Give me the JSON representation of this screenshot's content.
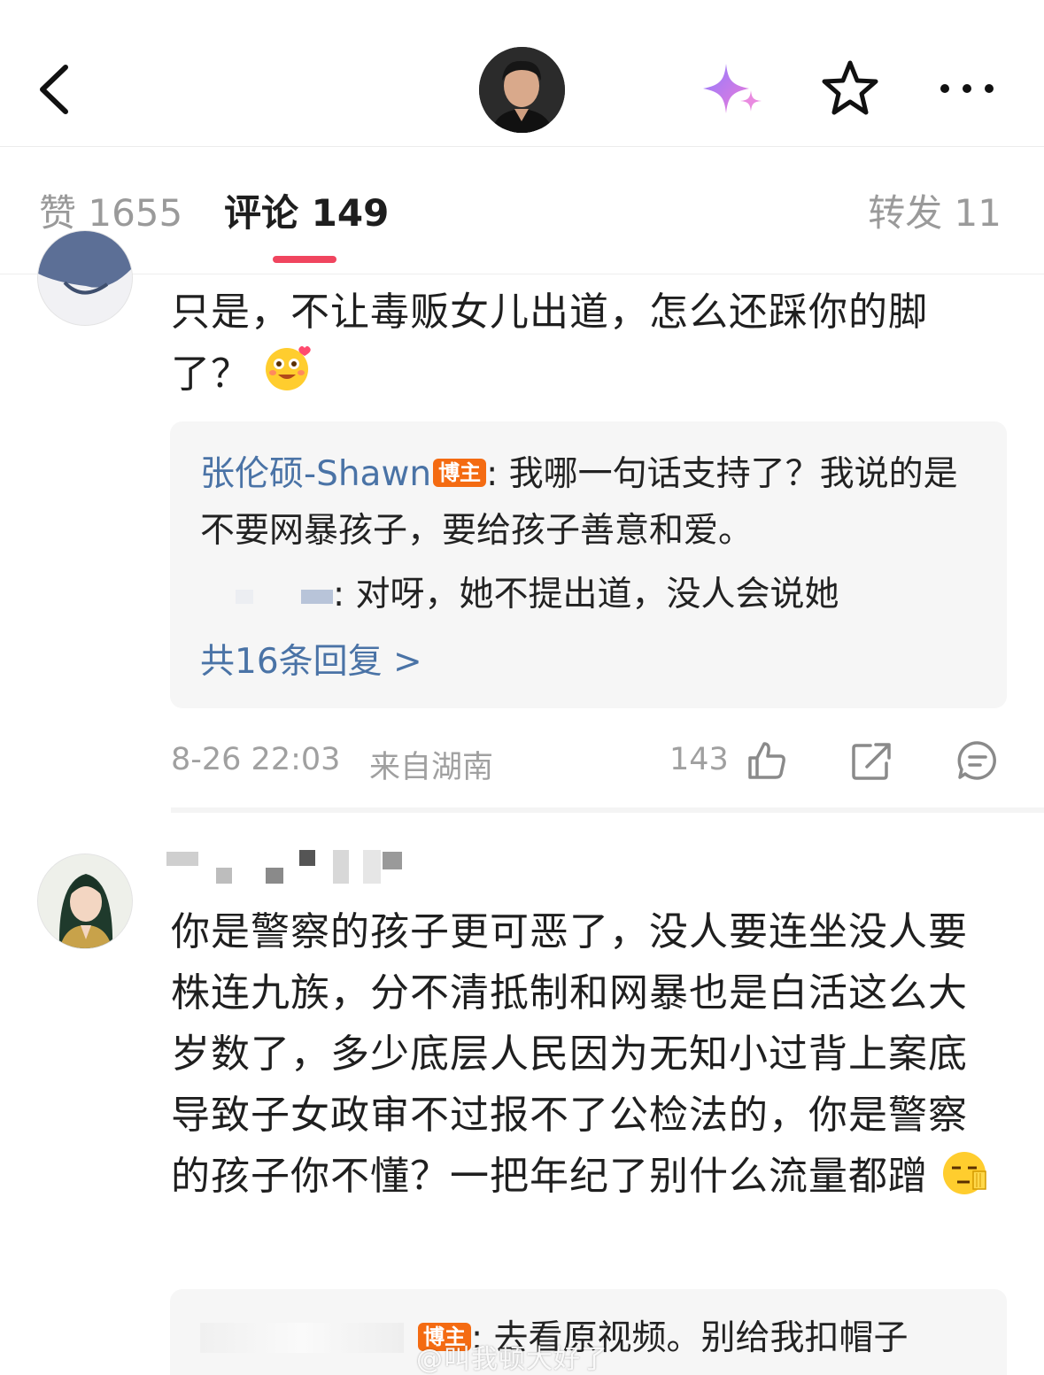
{
  "header": {
    "back_icon": "chevron-left-icon",
    "ai_icon": "sparkle-icon",
    "favorite_icon": "star-outline-icon",
    "more_icon": "more-dots-icon"
  },
  "tabs": {
    "likes": "赞 1655",
    "comments": "评论 149",
    "reposts": "转发 11",
    "accent_color": "#f0455f"
  },
  "comment1": {
    "text": "只是，不让毒贩女儿出道，怎么还踩你的脚了？",
    "emoji": "happy-blush-emoji",
    "reply_author": "张伦硕-Shawn",
    "author_badge": "博主",
    "reply_text": ": 我哪一句话支持了？我说的是不要网暴孩子，要给孩子善意和爱。",
    "sub_reply_text": ": 对呀，她不提出道，没人会说她",
    "more_replies": "共16条回复 >",
    "time": "8-26 22:03",
    "location": "来自湖南",
    "likes": "143"
  },
  "comment2": {
    "text": "你是警察的孩子更可恶了，没人要连坐没人要株连九族，分不清抵制和网暴也是白活这么大岁数了，多少底层人民因为无知小过背上案底导致子女政审不过报不了公检法的，你是警察的孩子你不懂？一把年纪了别什么流量都蹭",
    "emoji": "unamused-hand-emoji",
    "author_badge": "博主",
    "reply_text": ": 去看原视频。别给我扣帽子"
  },
  "watermark": "@叫我顿大好了",
  "colors": {
    "link_blue": "#4a73a6",
    "badge_orange": "#f46b12"
  }
}
